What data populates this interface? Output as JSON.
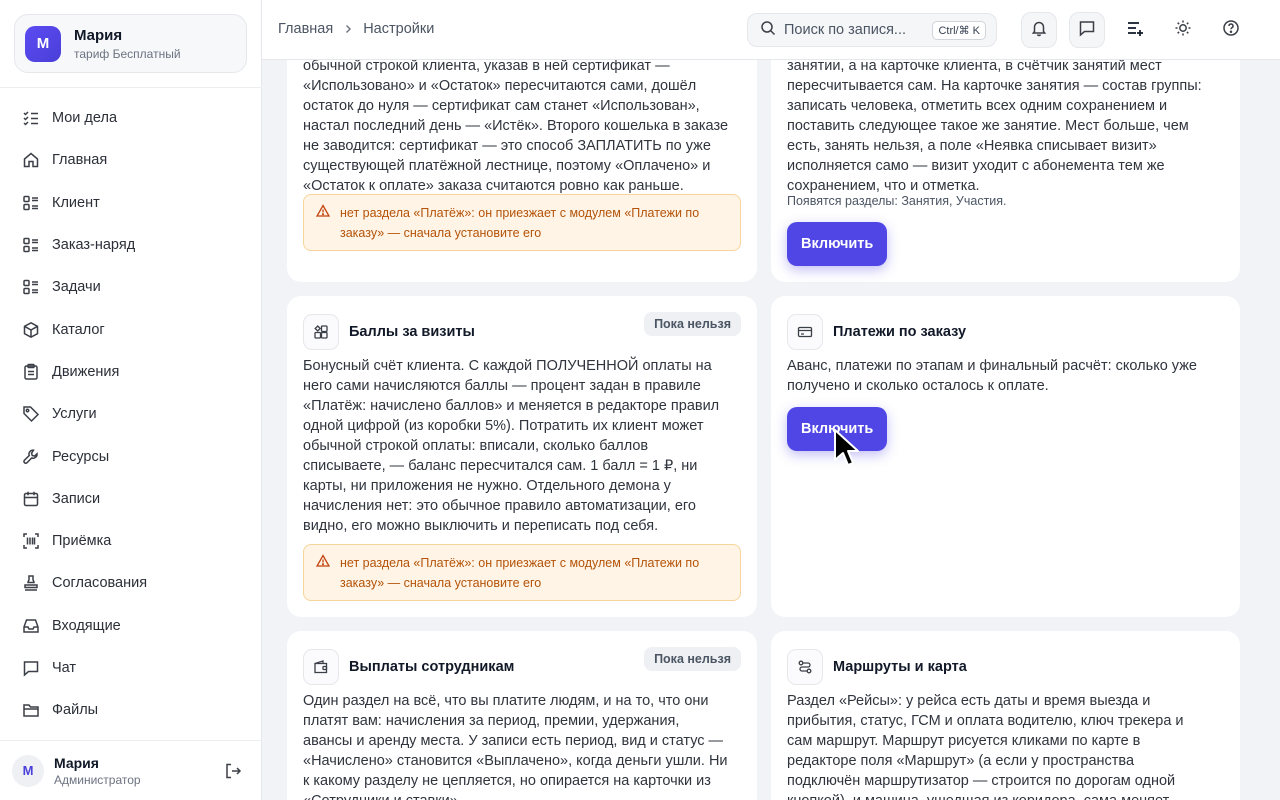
{
  "account": {
    "initial": "М",
    "name": "Мария",
    "plan": "тариф Бесплатный"
  },
  "nav": [
    {
      "label": "Мои дела",
      "icon": "checklist-icon"
    },
    {
      "label": "Главная",
      "icon": "home-icon"
    },
    {
      "label": "Клиент",
      "icon": "list-icon"
    },
    {
      "label": "Заказ-наряд",
      "icon": "list-icon"
    },
    {
      "label": "Задачи",
      "icon": "list-icon"
    },
    {
      "label": "Каталог",
      "icon": "box-icon"
    },
    {
      "label": "Движения",
      "icon": "clipboard-icon"
    },
    {
      "label": "Услуги",
      "icon": "tag-icon"
    },
    {
      "label": "Ресурсы",
      "icon": "wrench-icon"
    },
    {
      "label": "Записи",
      "icon": "calendar-icon"
    },
    {
      "label": "Приёмка",
      "icon": "scan-icon"
    },
    {
      "label": "Согласования",
      "icon": "stamp-icon"
    },
    {
      "label": "Входящие",
      "icon": "inbox-icon"
    },
    {
      "label": "Чат",
      "icon": "chat-icon"
    },
    {
      "label": "Файлы",
      "icon": "folder-icon"
    }
  ],
  "user": {
    "initial": "М",
    "name": "Мария",
    "role": "Администратор"
  },
  "topbar": {
    "crumb_home": "Главная",
    "crumb_current": "Настройки",
    "search_placeholder": "Поиск по запися...",
    "search_shortcut": "Ctrl/⌘ K"
  },
  "cards": {
    "certificates": {
      "text_lines": [
        "обычной строкой клиента, указав в ней сертификат —",
        "«Использовано» и «Остаток» пересчитаются сами, дошёл",
        "остаток до нуля — сертификат сам станет «Использован»,",
        "настал последний день — «Истёк». Второго кошелька в заказе",
        "не заводится: сертификат — это способ ЗАПЛАТИТЬ по уже",
        "существующей платёжной лестнице, поэтому «Оплачено» и",
        "«Остаток к оплате» заказа считаются ровно как раньше."
      ],
      "warning_lines": [
        "нет раздела «Платёж»: он приезжает с модулем «Платежи по",
        "заказу» — сначала установите его"
      ]
    },
    "classes": {
      "text_lines": [
        "занятии, а на карточке клиента, в счётчик занятий мест",
        "пересчитывается сам. На карточке занятия — состав группы:",
        "записать человека, отметить всех одним сохранением и",
        "поставить следующее такое же занятие. Мест больше, чем",
        "есть, занять нельзя, а поле «Неявка списывает визит»",
        "исполняется само — визит уходит с абонемента тем же",
        "сохранением, что и отметка."
      ],
      "note": "Появятся разделы: Занятия, Участия.",
      "button": "Включить"
    },
    "bonus": {
      "title": "Баллы за визиты",
      "status": "Пока нельзя",
      "text_lines": [
        "Бонусный счёт клиента. С каждой ПОЛУЧЕННОЙ оплаты на",
        "него сами начисляются баллы — процент задан в правиле",
        "«Платёж: начислено баллов» и меняется в редакторе правил",
        "одной цифрой (из коробки 5%). Потратить их клиент может",
        "обычной строкой оплаты: вписали, сколько баллов",
        "списываете, — баланс пересчитался сам. 1 балл = 1 ₽, ни",
        "карты, ни приложения не нужно. Отдельного демона у",
        "начисления нет: это обычное правило автоматизации, его",
        "видно, его можно выключить и переписать под себя."
      ],
      "warning_lines": [
        "нет раздела «Платёж»: он приезжает с модулем «Платежи по",
        "заказу» — сначала установите его"
      ]
    },
    "payments": {
      "title": "Платежи по заказу",
      "text_lines": [
        "Аванс, платежи по этапам и финальный расчёт: сколько уже",
        "получено и сколько осталось к оплате."
      ],
      "button": "Включить"
    },
    "payouts": {
      "title": "Выплаты сотрудникам",
      "status": "Пока нельзя",
      "text_lines": [
        "Один раздел на всё, что вы платите людям, и на то, что они",
        "платят вам: начисления за период, премии, удержания,",
        "авансы и аренду места. У записи есть период, вид и статус —",
        "«Начислено» становится «Выплачено», когда деньги ушли. Ни",
        "к какому разделу не цепляется, но опирается на карточки из",
        "«Сотрудники и ставки»."
      ]
    },
    "routes": {
      "title": "Маршруты и карта",
      "text_lines": [
        "Раздел «Рейсы»: у рейса есть даты и время выезда и",
        "прибытия, статус, ГСМ и оплата водителю, ключ трекера и",
        "сам маршрут. Маршрут рисуется кликами по карте в",
        "редакторе поля «Маршрут» (а если у пространства",
        "подключён маршрутизатор — строится по дорогам одной",
        "кнопкой), и машина, ушедшая из коридора, сама меняет"
      ]
    }
  },
  "colors": {
    "accent": "#4f46e5",
    "warning_bg": "#fff4e5",
    "warning_text": "#b45309"
  }
}
